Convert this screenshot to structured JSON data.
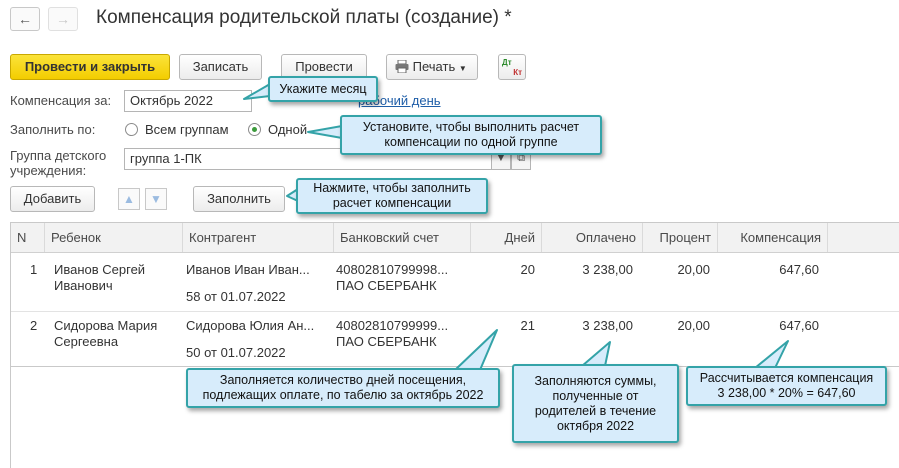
{
  "window": {
    "title": "Компенсация родительской платы (создание) *",
    "back_icon": "←",
    "forward_icon": "→"
  },
  "toolbar": {
    "post_close": "Провести и закрыть",
    "save": "Записать",
    "post": "Провести",
    "print": "Печать",
    "dt_label": "Дт",
    "kt_label": "Кт"
  },
  "form": {
    "compensation_label": "Компенсация за:",
    "compensation_value": "Октябрь 2022",
    "work_day_link": "рабочий день",
    "fill_label": "Заполнить по:",
    "fill_options": [
      "Всем группам",
      "Одной"
    ],
    "fill_selected": "Одной",
    "group_label_1": "Группа детского",
    "group_label_2": "учреждения:",
    "group_value": "группа 1-ПК"
  },
  "table_toolbar": {
    "add": "Добавить",
    "fill": "Заполнить"
  },
  "table": {
    "columns": [
      "N",
      "Ребенок",
      "Контрагент",
      "Банковский счет",
      "Дней",
      "Оплачено",
      "Процент",
      "Компенсация"
    ],
    "rows": [
      {
        "n": "1",
        "child_1": "Иванов Сергей",
        "child_2": "Иванович",
        "contractor": "Иванов Иван Иван...",
        "doc": "58 от 01.07.2022",
        "account": "40802810799998...",
        "bank": "ПАО СБЕРБАНК",
        "days": "20",
        "paid": "3 238,00",
        "percent": "20,00",
        "compensation": "647,60"
      },
      {
        "n": "2",
        "child_1": "Сидорова Мария",
        "child_2": "Сергеевна",
        "contractor": "Сидорова Юлия Ан...",
        "doc": "50 от 01.07.2022",
        "account": "40802810799999...",
        "bank": "ПАО СБЕРБАНК",
        "days": "21",
        "paid": "3 238,00",
        "percent": "20,00",
        "compensation": "647,60"
      }
    ]
  },
  "callouts": {
    "month": "Укажите месяц",
    "one_group_1": "Установите, чтобы выполнить расчет",
    "one_group_2": "компенсации по одной группе",
    "fill_1": "Нажмите, чтобы заполнить",
    "fill_2": "расчет компенсации",
    "days_1": "Заполняется количество дней посещения,",
    "days_2": "подлежащих оплате, по табелю за октябрь 2022",
    "paid_1": "Заполняются суммы,",
    "paid_2": "полученные от",
    "paid_3": "родителей в течение",
    "paid_4": "октября 2022",
    "comp_1": "Рассчитывается компенсация",
    "comp_2": "3 238,00 * 20% = 647,60"
  },
  "colors": {
    "primary_button": "#f3cd00",
    "callout_fill": "#d7ecfb",
    "callout_border": "#34a3a8",
    "link": "#1f5ea8"
  }
}
